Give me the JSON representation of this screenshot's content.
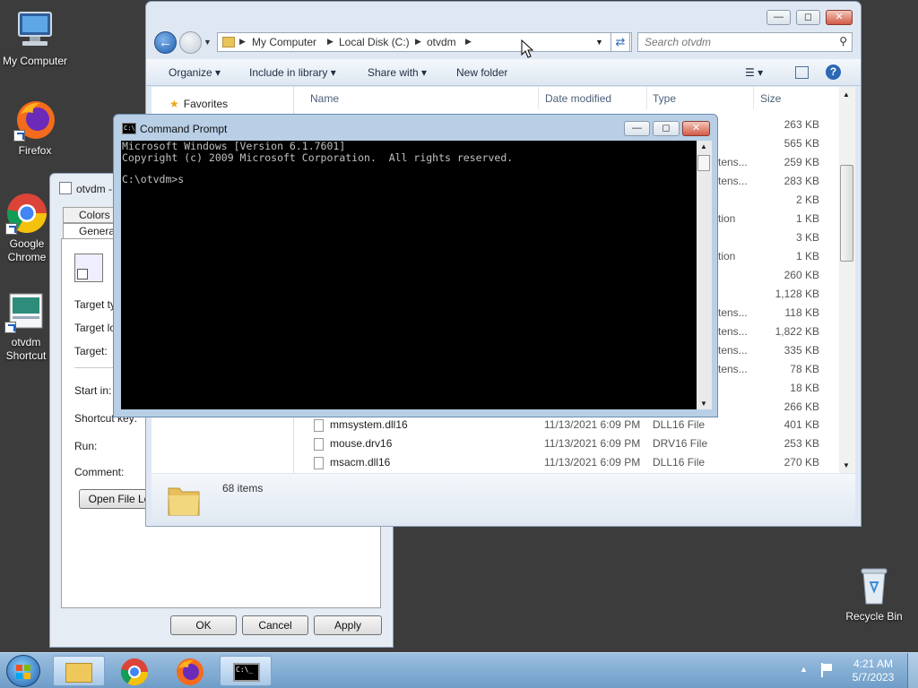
{
  "desktop": {
    "icons": [
      {
        "label": "My Computer"
      },
      {
        "label": "Firefox"
      },
      {
        "label": "Google Chrome"
      },
      {
        "label": "otvdm Shortcut"
      },
      {
        "label": "Recycle Bin"
      }
    ]
  },
  "properties_dialog": {
    "title": "otvdm -",
    "tabs": [
      "Colors",
      "General"
    ],
    "fields": [
      "Target ty",
      "Target lo",
      "Target:",
      "Start in:",
      "Shortcut key:",
      "Run:",
      "Comment:"
    ],
    "open_file_location": "Open File Lo",
    "ok": "OK",
    "cancel": "Cancel",
    "apply": "Apply"
  },
  "explorer": {
    "breadcrumb": [
      "My Computer",
      "Local Disk (C:)",
      "otvdm"
    ],
    "search_placeholder": "Search otvdm",
    "toolbar": [
      "Organize",
      "Include in library",
      "Share with",
      "New folder"
    ],
    "nav_favorites": "Favorites",
    "columns": [
      "Name",
      "Date modified",
      "Type",
      "Size"
    ],
    "partial_rows": [
      {
        "type": "",
        "size": "263 KB"
      },
      {
        "type": "",
        "size": "565 KB"
      },
      {
        "type": "tens...",
        "size": "259 KB"
      },
      {
        "type": "tens...",
        "size": "283 KB"
      },
      {
        "type": "",
        "size": "2 KB"
      },
      {
        "type": "tion",
        "size": "1 KB"
      },
      {
        "type": "",
        "size": "3 KB"
      },
      {
        "type": "tion",
        "size": "1 KB"
      },
      {
        "type": "",
        "size": "260 KB"
      },
      {
        "type": "",
        "size": "1,128 KB"
      },
      {
        "type": "tens...",
        "size": "118 KB"
      },
      {
        "type": "tens...",
        "size": "1,822 KB"
      },
      {
        "type": "tens...",
        "size": "335 KB"
      },
      {
        "type": "tens...",
        "size": "78 KB"
      },
      {
        "type": "",
        "size": "18 KB"
      },
      {
        "type": "",
        "size": "266 KB"
      }
    ],
    "rows": [
      {
        "name": "mmsystem.dll16",
        "date": "11/13/2021 6:09 PM",
        "type": "DLL16 File",
        "size": "401 KB"
      },
      {
        "name": "mouse.drv16",
        "date": "11/13/2021 6:09 PM",
        "type": "DRV16 File",
        "size": "253 KB"
      },
      {
        "name": "msacm.dll16",
        "date": "11/13/2021 6:09 PM",
        "type": "DLL16 File",
        "size": "270 KB"
      }
    ],
    "status": "68 items"
  },
  "cmd": {
    "title": "Command Prompt",
    "line1": "Microsoft Windows [Version 6.1.7601]",
    "line2": "Copyright (c) 2009 Microsoft Corporation.  All rights reserved.",
    "prompt": "C:\\otvdm>s"
  },
  "taskbar": {
    "time": "4:21 AM",
    "date": "5/7/2023"
  }
}
